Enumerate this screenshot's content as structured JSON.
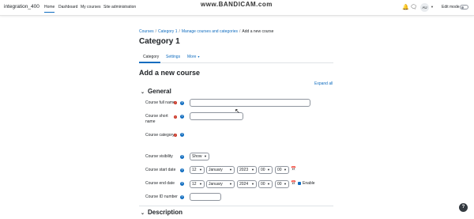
{
  "navbar": {
    "site_name": "integration_400",
    "links": [
      "Home",
      "Dashboard",
      "My courses",
      "Site administration"
    ],
    "watermark_prefix": "www.",
    "watermark": "BANDICAM",
    "watermark_suffix": ".com",
    "avatar_initials": "AU",
    "edit_mode_label": "Edit mode"
  },
  "breadcrumb": [
    "Courses",
    "Category 1",
    "Manage courses and categories",
    "Add a new course"
  ],
  "page_title": "Category 1",
  "tabs": [
    "Category",
    "Settings",
    "More"
  ],
  "heading": "Add a new course",
  "expand_all": "Expand all",
  "sections": {
    "general": "General",
    "description": "Description"
  },
  "fields": {
    "full_name": {
      "label": "Course full name",
      "value": ""
    },
    "short_name": {
      "label": "Course short name",
      "value": ""
    },
    "category": {
      "label": "Course category"
    },
    "visibility": {
      "label": "Course visibility",
      "value": "Show"
    },
    "start_date": {
      "label": "Course start date",
      "day": "12",
      "month": "January",
      "year": "2023",
      "hour": "00",
      "minute": "00"
    },
    "end_date": {
      "label": "Course end date",
      "day": "12",
      "month": "January",
      "year": "2024",
      "hour": "00",
      "minute": "00",
      "enable_label": "Enable",
      "enabled": true
    },
    "id_number": {
      "label": "Course ID number",
      "value": ""
    }
  },
  "colors": {
    "accent": "#0f6cbf",
    "required": "#ca3120"
  },
  "help_button": "?"
}
